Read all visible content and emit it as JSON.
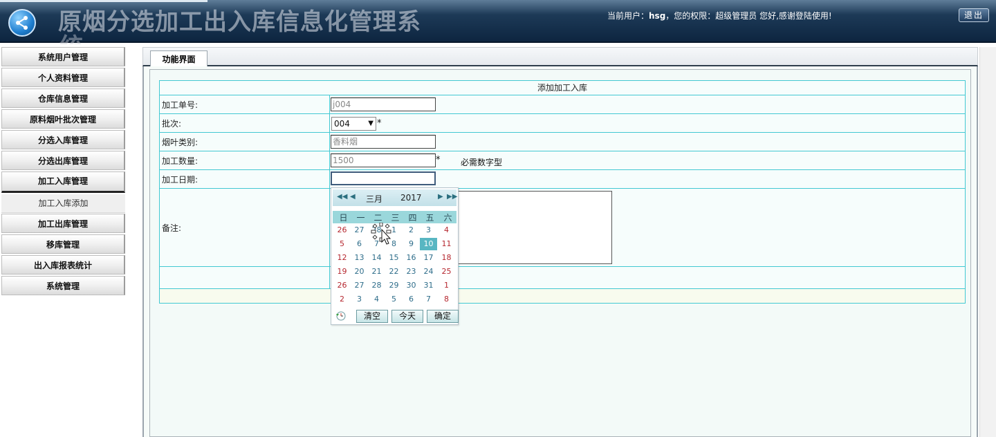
{
  "header": {
    "app_title": "原烟分选加工出入库信息化管理系",
    "app_title_overflow": "统",
    "user_label": "当前用户：",
    "username": "hsg",
    "role_text": "，您的权限：超级管理员 您好,感谢登陆使用!",
    "logout_label": "退出"
  },
  "sidebar": {
    "items": [
      {
        "label": "系统用户管理"
      },
      {
        "label": "个人资料管理"
      },
      {
        "label": "仓库信息管理"
      },
      {
        "label": "原料烟叶批次管理"
      },
      {
        "label": "分选入库管理"
      },
      {
        "label": "分选出库管理"
      },
      {
        "label": "加工入库管理"
      },
      {
        "label": "加工出库管理"
      },
      {
        "label": "移库管理"
      },
      {
        "label": "出入库报表统计"
      },
      {
        "label": "系统管理"
      }
    ],
    "submenu": {
      "label": "加工入库添加"
    }
  },
  "tab": {
    "label": "功能界面"
  },
  "form": {
    "title": "添加加工入库",
    "fields": {
      "order_no": {
        "label": "加工单号:",
        "value": "j004"
      },
      "batch": {
        "label": "批次:",
        "value": "004",
        "required_mark": "*"
      },
      "leaf_type": {
        "label": "烟叶类别:",
        "value": "香料烟"
      },
      "quantity": {
        "label": "加工数量:",
        "value": "1500",
        "required_mark": "*",
        "hint": "必需数字型"
      },
      "date": {
        "label": "加工日期:",
        "value": ""
      },
      "remark": {
        "label": "备注:",
        "value": ""
      }
    }
  },
  "calendar": {
    "month": "三月",
    "year": "2017",
    "weekdays": [
      "日",
      "一",
      "二",
      "三",
      "四",
      "五",
      "六"
    ],
    "weeks": [
      [
        "26",
        "27",
        "28",
        "1",
        "2",
        "3",
        "4"
      ],
      [
        "5",
        "6",
        "7",
        "8",
        "9",
        "10",
        "11"
      ],
      [
        "12",
        "13",
        "14",
        "15",
        "16",
        "17",
        "18"
      ],
      [
        "19",
        "20",
        "21",
        "22",
        "23",
        "24",
        "25"
      ],
      [
        "26",
        "27",
        "28",
        "29",
        "30",
        "31",
        "1"
      ],
      [
        "2",
        "3",
        "4",
        "5",
        "6",
        "7",
        "8"
      ]
    ],
    "today": "10",
    "buttons": {
      "clear": "清空",
      "today": "今天",
      "ok": "确定"
    }
  },
  "colors": {
    "header_bg": "#1d3a57",
    "table_border": "#42c8d2",
    "calendar_today": "#58b6c2",
    "weekend": "#b5262e"
  }
}
